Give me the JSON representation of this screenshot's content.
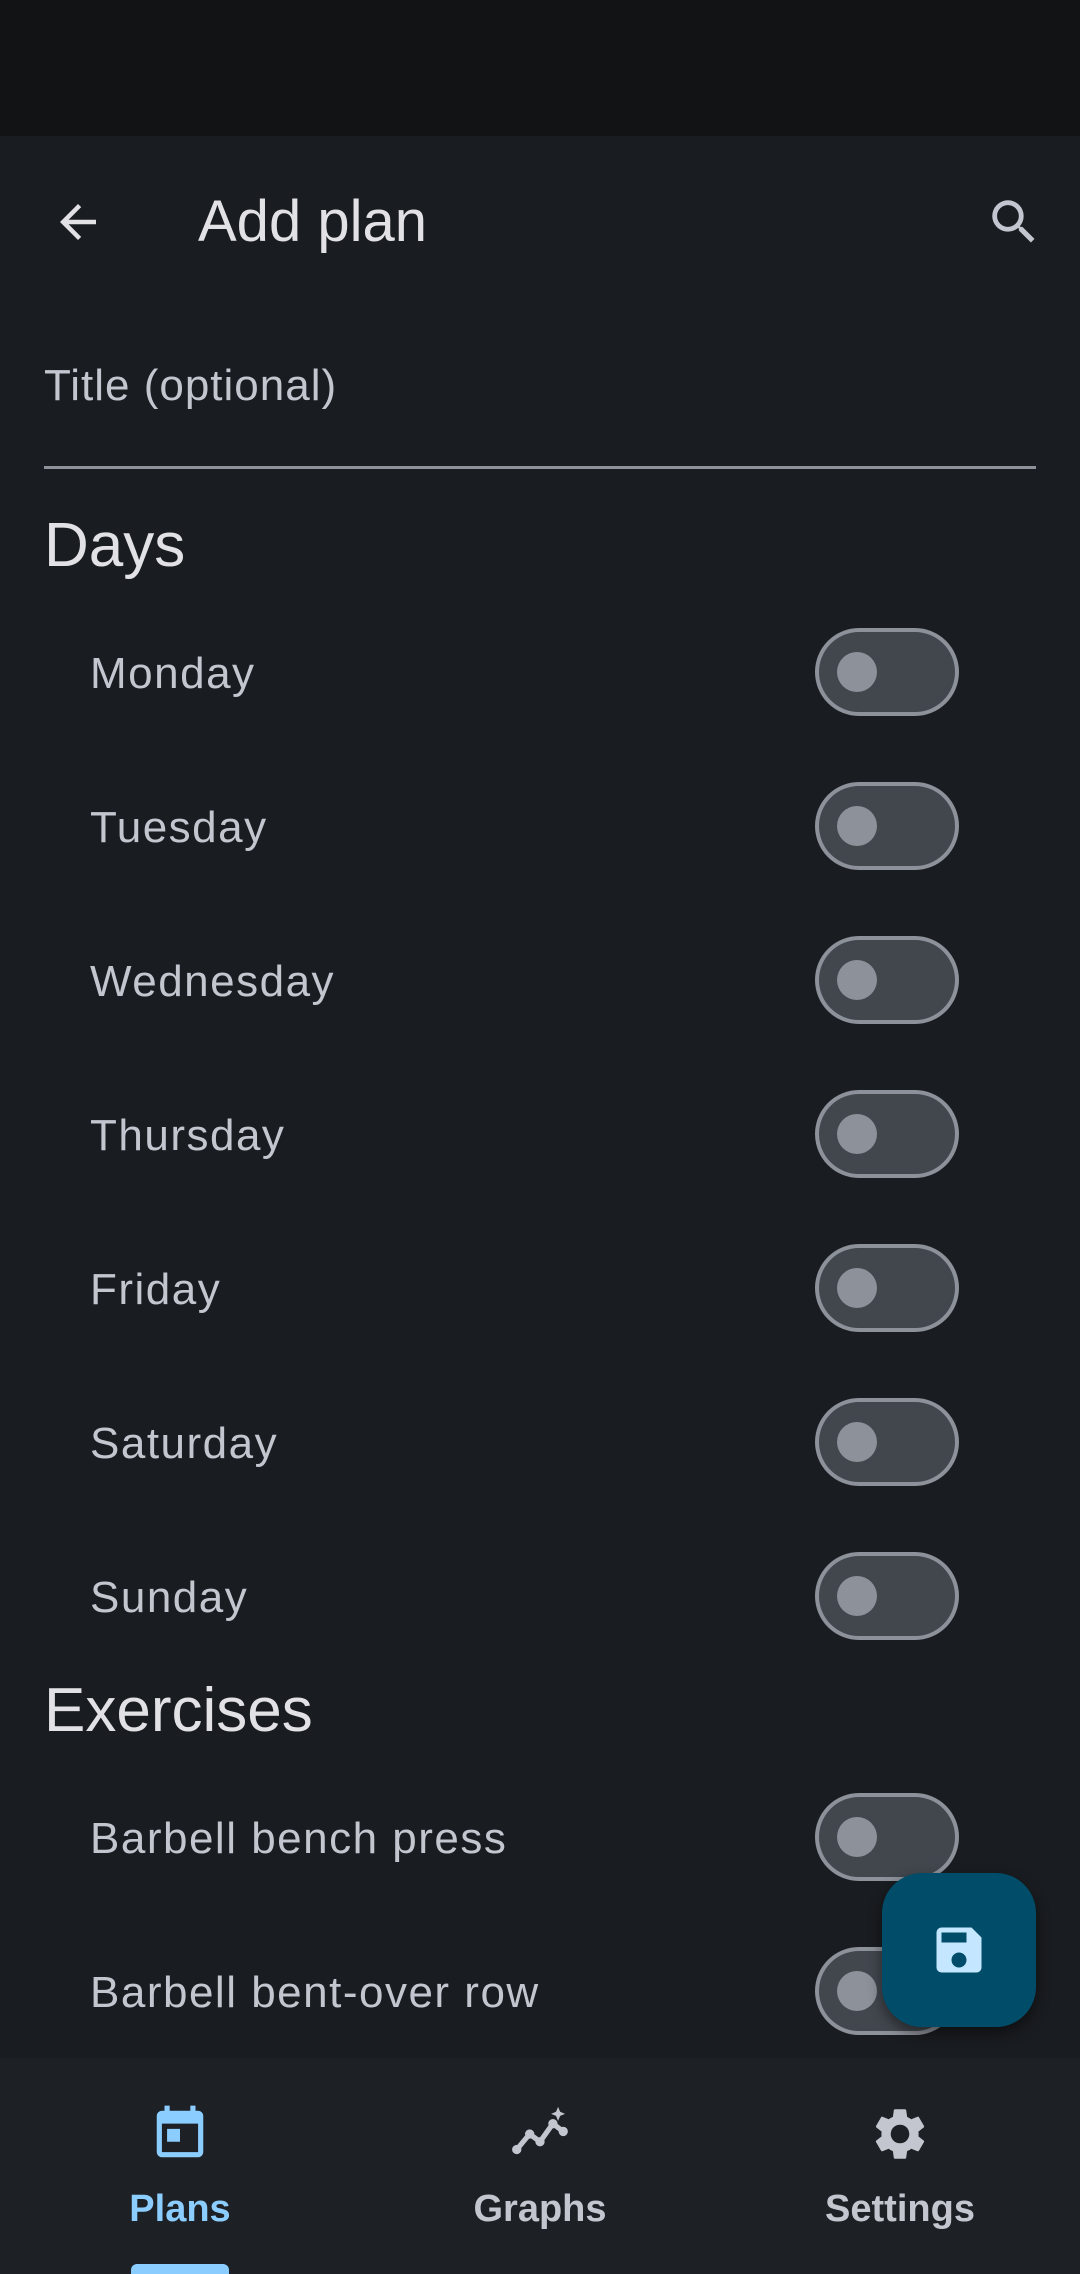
{
  "app_bar": {
    "title": "Add plan",
    "back_icon": "arrow-back-icon",
    "search_icon": "search-icon"
  },
  "title_field": {
    "placeholder": "Title (optional)",
    "value": ""
  },
  "days": {
    "heading": "Days",
    "items": [
      {
        "label": "Monday",
        "checked": false
      },
      {
        "label": "Tuesday",
        "checked": false
      },
      {
        "label": "Wednesday",
        "checked": false
      },
      {
        "label": "Thursday",
        "checked": false
      },
      {
        "label": "Friday",
        "checked": false
      },
      {
        "label": "Saturday",
        "checked": false
      },
      {
        "label": "Sunday",
        "checked": false
      }
    ]
  },
  "exercises": {
    "heading": "Exercises",
    "items": [
      {
        "label": "Barbell bench press",
        "checked": false
      },
      {
        "label": "Barbell bent-over row",
        "checked": false
      }
    ]
  },
  "fab": {
    "icon": "save-icon"
  },
  "bottom_nav": {
    "items": [
      {
        "label": "Plans",
        "icon": "calendar-icon",
        "active": true
      },
      {
        "label": "Graphs",
        "icon": "graph-icon",
        "active": false
      },
      {
        "label": "Settings",
        "icon": "gear-icon",
        "active": false
      }
    ]
  },
  "colors": {
    "background": "#191c20",
    "status_bar": "#111315",
    "nav_background": "#1d2024",
    "accent": "#8ccdff",
    "fab_background": "#004c69",
    "switch_track": "#42474e",
    "switch_outline": "#8d9199"
  }
}
